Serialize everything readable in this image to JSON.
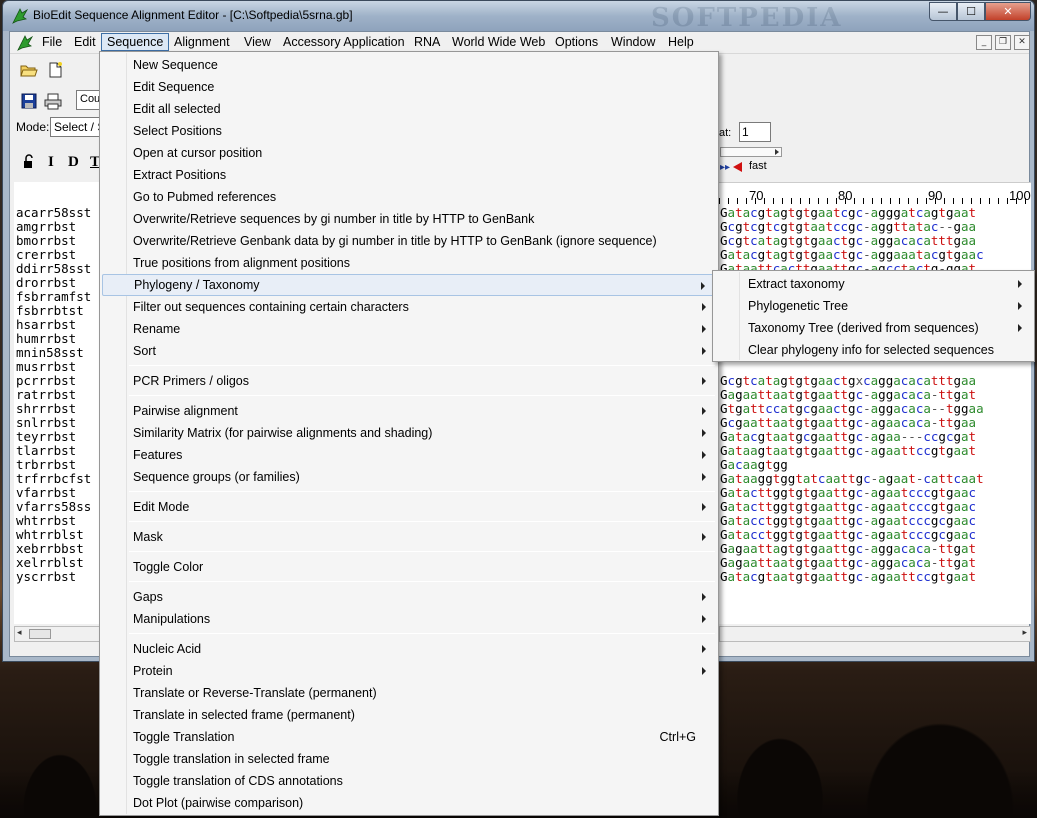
{
  "window": {
    "title": "BioEdit Sequence Alignment Editor - [C:\\Softpedia\\5srna.gb]",
    "watermark": "SOFTPEDIA",
    "controls": {
      "minimize": "—",
      "maximize": "☐",
      "close": "✕"
    }
  },
  "menubar": {
    "items": [
      "File",
      "Edit",
      "Sequence",
      "Alignment",
      "View",
      "Accessory Application",
      "RNA",
      "World Wide Web",
      "Options",
      "Window",
      "Help"
    ],
    "active": "Sequence",
    "mdi_controls": {
      "minimize": "_",
      "restore": "❐",
      "close": "✕"
    }
  },
  "toolbar": {
    "font_box": "Cour",
    "mode_label": "Mode:",
    "mode_value": "Select / S",
    "edit_tools": [
      "I",
      "D",
      "T"
    ],
    "position_label": "at:",
    "position_value": "1",
    "speed_label": "fast"
  },
  "ruler": {
    "numbers": [
      "70",
      "80",
      "90",
      "100"
    ]
  },
  "sequence_names": [
    "acarr58sst",
    "amgrrbst",
    "bmorrbst",
    "crerrbst",
    "ddirr58sst",
    "drorrbst",
    "fsbrramfst",
    "fsbrrbtst",
    "hsarrbst",
    "humrrbst",
    "mnin58sst",
    "musrrbst",
    "pcrrrbst",
    "ratrrbst",
    "shrrrbst",
    "snlrrbst",
    "teyrrbst",
    "tlarrbst",
    "trbrrbst",
    "trfrrbcfst",
    "vfarrbst",
    "vfarrs58ss",
    "whtrrbst",
    "whtrrblst",
    "xebrrbbst",
    "xelrrblst",
    "yscrrbst"
  ],
  "sequences": [
    "Gatacgtagtgtgaatcgc-agggatcagtgaat",
    "Gcgtcgtcgtgtaatccgc-aggttatac--gaa",
    "Gcgtcatagtgtgaactgc-aggacacatttgaa",
    "Gatacgtagtgtgaactgc-aggaaatacgtgaac",
    "Gataattcacttgaattgc-agcctactg-ggat",
    "",
    "",
    "",
    "",
    "",
    "",
    "",
    "Gcgtcatagtgtgaactgxcaggacacatttgaa",
    "Gagaattaatgtgaattgc-aggacaca-ttgat",
    "Gtgattccatgcgaactgc-aggacaca--tggaa",
    "Gcgaattaatgtgaattgc-agaacaca-ttgaa",
    "Gatacgtaatgcgaattgc-agaa---ccgcgat",
    "Gataagtaatgtgaattgc-agaattccgtgaat",
    "Gacaagtgg",
    "Gataaggtggtatcaattgc-agaat-cattcaat",
    "Gatacttggtgtgaattgc-agaatcccgtgaac",
    "Gatacttggtgtgaattgc-agaatcccgtgaac",
    "Gatacctggtgtgaattgc-agaatcccgcgaac",
    "Gatacctggtgtgaattgc-agaatcccgcgaac",
    "Gagaattagtgtgaattgc-aggacaca-ttgat",
    "Gagaattaatgtgaattgc-aggacaca-ttgat",
    "Gatacgtaatgtgaattgc-agaattccgtgaat"
  ],
  "sequence_menu": {
    "items": [
      {
        "label": "New Sequence",
        "submenu": false
      },
      {
        "label": "Edit Sequence",
        "submenu": false
      },
      {
        "label": "Edit all selected",
        "submenu": false
      },
      {
        "label": "Select Positions",
        "submenu": false
      },
      {
        "label": "Open at cursor position",
        "submenu": false
      },
      {
        "label": "Extract Positions",
        "submenu": false
      },
      {
        "label": "Go to Pubmed references",
        "submenu": false
      },
      {
        "label": "Overwrite/Retrieve sequences by gi number in title by HTTP to GenBank",
        "submenu": false
      },
      {
        "label": "Overwrite/Retrieve Genbank data by gi number in title by HTTP to GenBank (ignore sequence)",
        "submenu": false
      },
      {
        "label": "True positions from alignment positions",
        "submenu": false
      },
      {
        "label": "Phylogeny / Taxonomy",
        "submenu": true,
        "highlight": true
      },
      {
        "label": "Filter out sequences containing certain characters",
        "submenu": true
      },
      {
        "label": "Rename",
        "submenu": true
      },
      {
        "label": "Sort",
        "submenu": true
      },
      {
        "label": "PCR Primers / oligos",
        "submenu": true
      },
      {
        "label": "Pairwise alignment",
        "submenu": true
      },
      {
        "label": "Similarity Matrix (for pairwise alignments and shading)",
        "submenu": true
      },
      {
        "label": "Features",
        "submenu": true
      },
      {
        "label": "Sequence groups (or families)",
        "submenu": true
      },
      {
        "label": "Edit Mode",
        "submenu": true
      },
      {
        "label": "Mask",
        "submenu": true
      },
      {
        "label": "Toggle Color",
        "submenu": false
      },
      {
        "label": "Gaps",
        "submenu": true
      },
      {
        "label": "Manipulations",
        "submenu": true
      },
      {
        "label": "Nucleic Acid",
        "submenu": true
      },
      {
        "label": "Protein",
        "submenu": true
      },
      {
        "label": "Translate or Reverse-Translate (permanent)",
        "submenu": false
      },
      {
        "label": "Translate in selected frame (permanent)",
        "submenu": false
      },
      {
        "label": "Toggle Translation",
        "submenu": false,
        "shortcut": "Ctrl+G"
      },
      {
        "label": "Toggle translation in selected frame",
        "submenu": false
      },
      {
        "label": "Toggle translation of CDS annotations",
        "submenu": false
      },
      {
        "label": "Dot Plot (pairwise comparison)",
        "submenu": false
      }
    ]
  },
  "phylogeny_submenu": {
    "items": [
      {
        "label": "Extract taxonomy",
        "submenu": true
      },
      {
        "label": "Phylogenetic Tree",
        "submenu": true
      },
      {
        "label": "Taxonomy Tree (derived from sequences)",
        "submenu": true
      },
      {
        "label": "Clear phylogeny info for selected sequences",
        "submenu": false
      }
    ]
  },
  "colors": {
    "A": "#2e8b2e",
    "C": "#1f2fd0",
    "G": "#000000",
    "T": "#cc1010",
    "menu_highlight": "#e8eef7"
  }
}
